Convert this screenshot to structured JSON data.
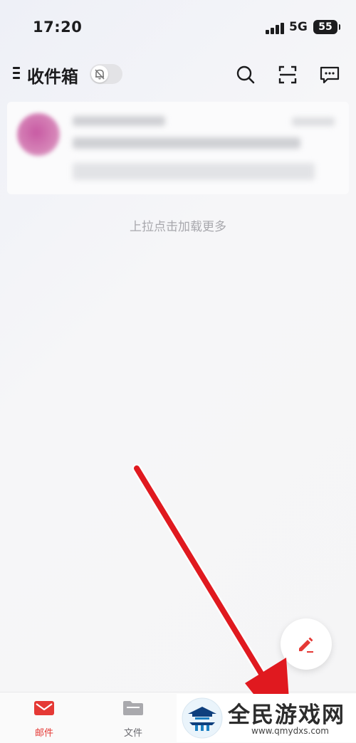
{
  "status_bar": {
    "time": "17:20",
    "network": "5G",
    "battery": "55"
  },
  "header": {
    "title": "收件箱"
  },
  "list": {
    "load_more": "上拉点击加载更多"
  },
  "tabs": [
    {
      "label": "邮件",
      "icon": "mail-icon",
      "active": true
    },
    {
      "label": "文件",
      "icon": "folder-icon",
      "active": false
    }
  ],
  "watermark": {
    "brand": "全民游戏网",
    "url": "www.qmydxs.com"
  },
  "colors": {
    "accent": "#e53935",
    "arrow": "#e0191f",
    "muted_text": "#a8a8ad"
  }
}
